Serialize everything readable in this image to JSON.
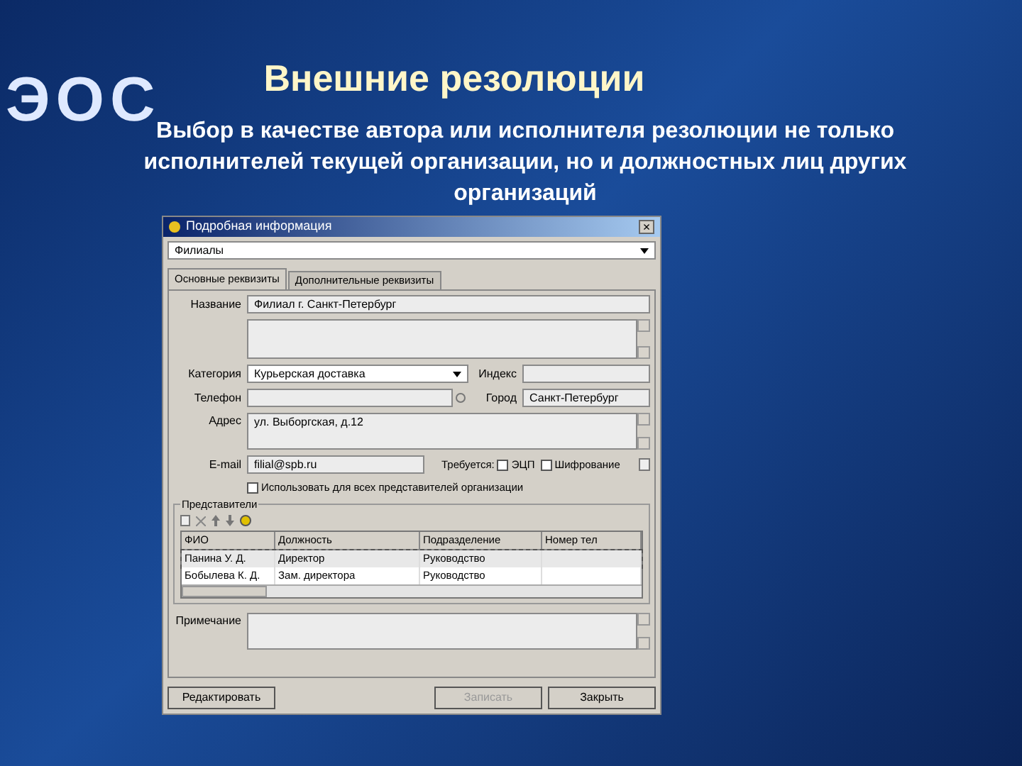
{
  "logo": "ЭОС",
  "slide": {
    "title": "Внешние резолюции",
    "subtitle": "Выбор в качестве автора или исполнителя резолюции не только исполнителей текущей организации, но и должностных лиц других организаций"
  },
  "window": {
    "title": "Подробная информация",
    "close": "×",
    "group_select": "Филиалы",
    "tabs": [
      {
        "label": "Основные реквизиты",
        "selected": true
      },
      {
        "label": "Дополнительные реквизиты",
        "selected": false
      }
    ],
    "fields": {
      "name_label": "Название",
      "name": "Филиал г. Санкт-Петербург",
      "category_label": "Категория",
      "category": "Курьерская доставка",
      "index_label": "Индекс",
      "phone_label": "Телефон",
      "city_label": "Город",
      "city": "Санкт-Петербург",
      "address_label": "Адрес",
      "address": "ул. Выборгская, д.12",
      "email_label": "E-mail",
      "email": "filial@spb.ru",
      "requires_label": "Требуется:"
    },
    "requires": [
      {
        "label": "ЭЦП",
        "checked": false
      },
      {
        "label": "Шифрование",
        "checked": false
      }
    ],
    "use_for_all": {
      "label": "Использовать для всех представителей организации",
      "checked": false
    },
    "reps": {
      "title": "Представители",
      "columns": [
        "ФИО",
        "Должность",
        "Подразделение",
        "Номер тел"
      ],
      "rows": [
        {
          "cells": [
            "Панина У. Д.",
            "Директор",
            "Руководство",
            ""
          ],
          "selected": true
        },
        {
          "cells": [
            "Бобылева К. Д.",
            "Зам. директора",
            "Руководство",
            ""
          ],
          "selected": false
        }
      ]
    },
    "note_label": "Примечание",
    "buttons": [
      {
        "label": "Редактировать",
        "disabled": false
      },
      {
        "label": "Записать",
        "disabled": true
      },
      {
        "label": "Закрыть",
        "disabled": false
      }
    ]
  }
}
